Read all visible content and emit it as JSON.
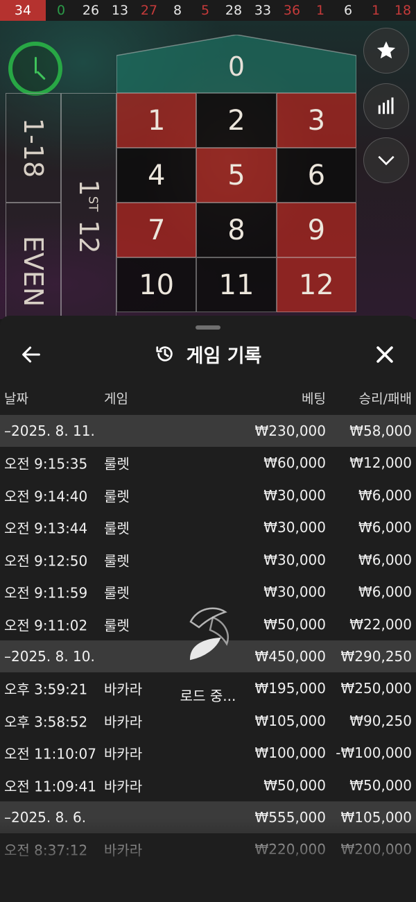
{
  "history_strip": [
    {
      "n": "34",
      "color": "red",
      "current": true
    },
    {
      "n": "0",
      "color": "green"
    },
    {
      "n": "26",
      "color": "black"
    },
    {
      "n": "13",
      "color": "black"
    },
    {
      "n": "27",
      "color": "red"
    },
    {
      "n": "8",
      "color": "black"
    },
    {
      "n": "5",
      "color": "red"
    },
    {
      "n": "28",
      "color": "black"
    },
    {
      "n": "33",
      "color": "black"
    },
    {
      "n": "36",
      "color": "red"
    },
    {
      "n": "1",
      "color": "red"
    },
    {
      "n": "6",
      "color": "black"
    },
    {
      "n": "1",
      "color": "red"
    },
    {
      "n": "18",
      "color": "red"
    }
  ],
  "board": {
    "zero": "0",
    "numbers": [
      {
        "n": "1",
        "color": "red"
      },
      {
        "n": "2",
        "color": "black"
      },
      {
        "n": "3",
        "color": "red"
      },
      {
        "n": "4",
        "color": "black"
      },
      {
        "n": "5",
        "color": "red"
      },
      {
        "n": "6",
        "color": "black"
      },
      {
        "n": "7",
        "color": "red"
      },
      {
        "n": "8",
        "color": "black"
      },
      {
        "n": "9",
        "color": "red"
      },
      {
        "n": "10",
        "color": "black"
      },
      {
        "n": "11",
        "color": "black"
      },
      {
        "n": "12",
        "color": "red"
      }
    ],
    "outside_low": "1-18",
    "outside_even": "EVEN",
    "dozen_num": "1",
    "dozen_sup": "ST",
    "dozen_rest": " 12"
  },
  "side_buttons": [
    "star-icon",
    "stats-icon",
    "chevron-down-icon"
  ],
  "sheet": {
    "title": "게임 기록",
    "columns": {
      "date": "날짜",
      "game": "게임",
      "bet": "베팅",
      "win": "승리/패배"
    },
    "groups": [
      {
        "date": "–2025. 8. 11.",
        "bet": "₩230,000",
        "win": "₩58,000",
        "rows": [
          {
            "time": "오전 9:15:35",
            "game": "룰렛",
            "bet": "₩60,000",
            "win": "₩12,000"
          },
          {
            "time": "오전 9:14:40",
            "game": "룰렛",
            "bet": "₩30,000",
            "win": "₩6,000"
          },
          {
            "time": "오전 9:13:44",
            "game": "룰렛",
            "bet": "₩30,000",
            "win": "₩6,000"
          },
          {
            "time": "오전 9:12:50",
            "game": "룰렛",
            "bet": "₩30,000",
            "win": "₩6,000"
          },
          {
            "time": "오전 9:11:59",
            "game": "룰렛",
            "bet": "₩30,000",
            "win": "₩6,000"
          },
          {
            "time": "오전 9:11:02",
            "game": "룰렛",
            "bet": "₩50,000",
            "win": "₩22,000"
          }
        ]
      },
      {
        "date": "–2025. 8. 10.",
        "bet": "₩450,000",
        "win": "₩290,250",
        "rows": [
          {
            "time": "오후 3:59:21",
            "game": "바카라",
            "bet": "₩195,000",
            "win": "₩250,000"
          },
          {
            "time": "오후 3:58:52",
            "game": "바카라",
            "bet": "₩105,000",
            "win": "₩90,250"
          },
          {
            "time": "오전 11:10:07",
            "game": "바카라",
            "bet": "₩100,000",
            "win": "-₩100,000"
          },
          {
            "time": "오전 11:09:41",
            "game": "바카라",
            "bet": "₩50,000",
            "win": "₩50,000"
          }
        ]
      },
      {
        "date": "–2025. 8. 6.",
        "bet": "₩555,000",
        "win": "₩105,000",
        "rows": [
          {
            "time": "오전 8:37:12",
            "game": "바카라",
            "bet": "₩220,000",
            "win": "₩200,000"
          }
        ]
      }
    ],
    "loading_text": "로드 중..."
  },
  "colors": {
    "red": "#b5322f",
    "green": "#28a745",
    "date_row_bg": "#3b3b3b",
    "sheet_bg": "#1e1e1e"
  }
}
